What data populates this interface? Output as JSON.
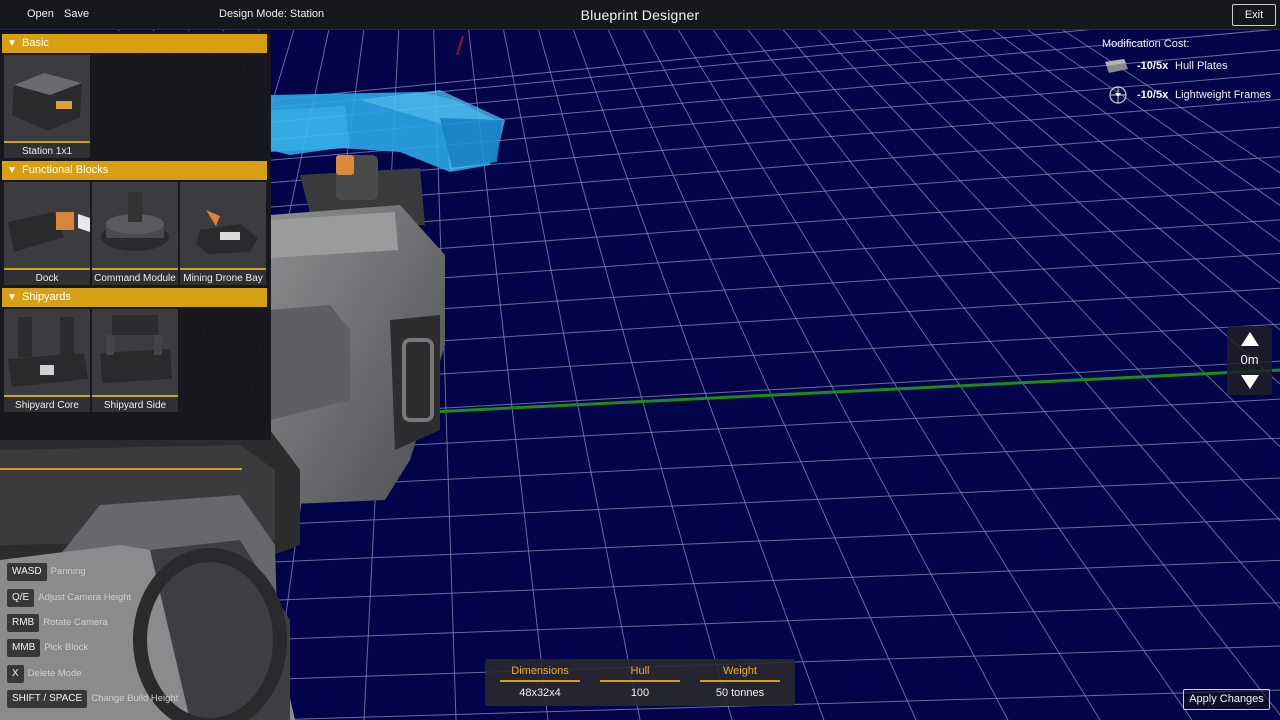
{
  "topbar": {
    "open_label": "Open",
    "save_label": "Save",
    "design_mode": "Design Mode: Station",
    "title": "Blueprint Designer",
    "exit_label": "Exit"
  },
  "palette": {
    "categories": [
      {
        "label": "Basic",
        "items": [
          {
            "label": "Station 1x1",
            "icon": "station-block-icon"
          }
        ]
      },
      {
        "label": "Functional Blocks",
        "items": [
          {
            "label": "Dock",
            "icon": "dock-icon"
          },
          {
            "label": "Command Module",
            "icon": "command-module-icon"
          },
          {
            "label": "Mining Drone Bay",
            "icon": "mining-drone-bay-icon"
          }
        ]
      },
      {
        "label": "Shipyards",
        "items": [
          {
            "label": "Shipyard Core",
            "icon": "shipyard-core-icon"
          },
          {
            "label": "Shipyard Side",
            "icon": "shipyard-side-icon"
          }
        ]
      }
    ]
  },
  "modification_cost": {
    "title": "Modification Cost:",
    "items": [
      {
        "amount": "-10/5x",
        "name": "Hull Plates",
        "icon": "hull-plate-icon"
      },
      {
        "amount": "-10/5x",
        "name": "Lightweight Frames",
        "icon": "lightweight-frame-icon"
      }
    ]
  },
  "height_control": {
    "value": "0m"
  },
  "key_hints": [
    {
      "key": "WASD",
      "action": "Panning"
    },
    {
      "key": "Q/E",
      "action": "Adjust Camera Height"
    },
    {
      "key": "RMB",
      "action": "Rotate Camera"
    },
    {
      "key": "MMB",
      "action": "Pick Block"
    },
    {
      "key": "X",
      "action": "Delete Mode"
    },
    {
      "key": "SHIFT / SPACE",
      "action": "Change Build Height"
    }
  ],
  "stats": {
    "dimensions_label": "Dimensions",
    "dimensions_value": "48x32x4",
    "hull_label": "Hull",
    "hull_value": "100",
    "weight_label": "Weight",
    "weight_value": "50 tonnes"
  },
  "apply_label": "Apply Changes",
  "colors": {
    "accent": "#d7a014",
    "grid_background": "#03034a",
    "grid_lines": "#8a8fb5",
    "x_axis": "#1a8c1a",
    "ghost_block": "#29b6f2"
  }
}
